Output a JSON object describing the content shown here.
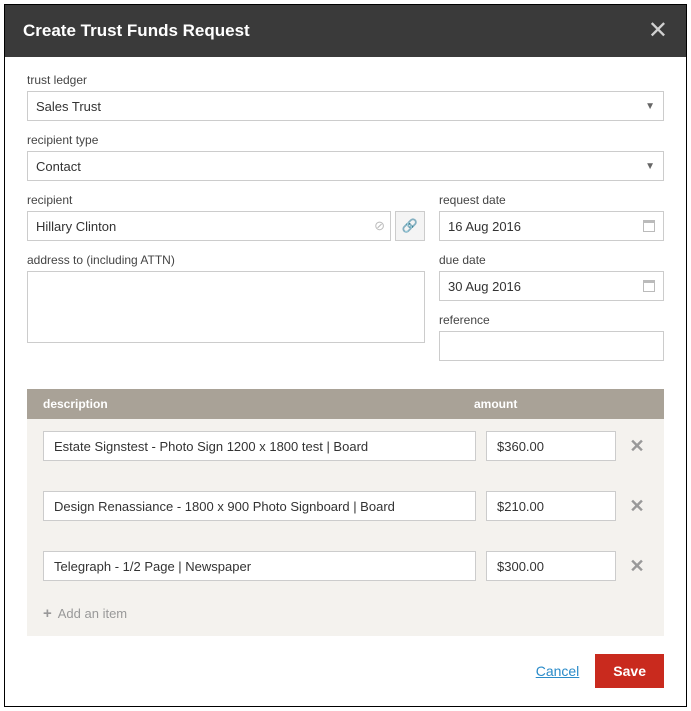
{
  "header": {
    "title": "Create Trust Funds Request"
  },
  "fields": {
    "trust_ledger": {
      "label": "trust ledger",
      "value": "Sales Trust"
    },
    "recipient_type": {
      "label": "recipient type",
      "value": "Contact"
    },
    "recipient": {
      "label": "recipient",
      "value": "Hillary Clinton"
    },
    "address_to": {
      "label": "address to (including ATTN)",
      "value": ""
    },
    "request_date": {
      "label": "request date",
      "value": "16 Aug 2016"
    },
    "due_date": {
      "label": "due date",
      "value": "30 Aug 2016"
    },
    "reference": {
      "label": "reference",
      "value": ""
    }
  },
  "items": {
    "header_desc": "description",
    "header_amount": "amount",
    "rows": [
      {
        "description": "Estate Signstest - Photo Sign 1200 x 1800 test | Board",
        "amount": "$360.00"
      },
      {
        "description": "Design Renassiance - 1800 x 900 Photo Signboard | Board",
        "amount": "$210.00"
      },
      {
        "description": "Telegraph - 1/2 Page | Newspaper",
        "amount": "$300.00"
      }
    ],
    "add_label": "Add an item"
  },
  "footer": {
    "cancel": "Cancel",
    "save": "Save"
  }
}
